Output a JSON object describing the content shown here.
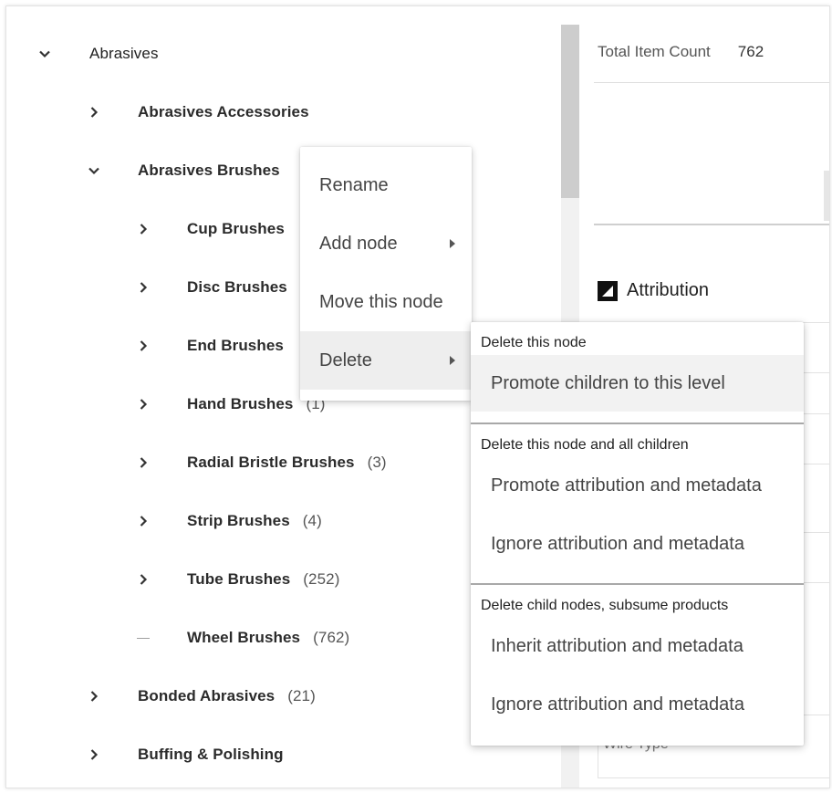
{
  "tree": {
    "root": {
      "label": "Abrasives",
      "expanded": true
    },
    "items": [
      {
        "label": "Abrasives Accessories",
        "count": "",
        "level": 1,
        "state": "collapsed"
      },
      {
        "label": "Abrasives Brushes",
        "count": "",
        "level": 1,
        "state": "expanded"
      },
      {
        "label": "Cup Brushes",
        "count": "",
        "level": 2,
        "state": "collapsed"
      },
      {
        "label": "Disc Brushes",
        "count": "",
        "level": 2,
        "state": "collapsed"
      },
      {
        "label": "End Brushes",
        "count": "",
        "level": 2,
        "state": "collapsed"
      },
      {
        "label": "Hand Brushes",
        "count": "(1)",
        "level": 2,
        "state": "collapsed"
      },
      {
        "label": "Radial Bristle Brushes",
        "count": "(3)",
        "level": 2,
        "state": "collapsed"
      },
      {
        "label": "Strip Brushes",
        "count": "(4)",
        "level": 2,
        "state": "collapsed"
      },
      {
        "label": "Tube Brushes",
        "count": "(252)",
        "level": 2,
        "state": "collapsed"
      },
      {
        "label": "Wheel Brushes",
        "count": "(762)",
        "level": 2,
        "state": "leaf"
      },
      {
        "label": "Bonded Abrasives",
        "count": "(21)",
        "level": 1,
        "state": "collapsed"
      },
      {
        "label": "Buffing & Polishing",
        "count": "",
        "level": 1,
        "state": "collapsed"
      }
    ]
  },
  "context_menu": {
    "items": [
      {
        "label": "Rename",
        "has_submenu": false
      },
      {
        "label": "Add node",
        "has_submenu": true
      },
      {
        "label": "Move this node",
        "has_submenu": false
      },
      {
        "label": "Delete",
        "has_submenu": true,
        "active": true
      }
    ]
  },
  "delete_submenu": {
    "groups": [
      {
        "heading": "Delete this node",
        "options": [
          "Promote children to this level"
        ]
      },
      {
        "heading": "Delete this node and all children",
        "options": [
          "Promote attribution and metadata",
          "Ignore attribution and metadata"
        ]
      },
      {
        "heading": "Delete child nodes, subsume products",
        "options": [
          "Inherit attribution and metadata",
          "Ignore attribution and metadata"
        ]
      }
    ]
  },
  "details": {
    "total_item_count_label": "Total Item Count",
    "total_item_count_value": "762",
    "attribution_title": "Attribution",
    "partial_field_label": "Wire Type"
  },
  "colors": {
    "text": "#2b2b2b",
    "menu_active_bg": "#eeeeee",
    "scroll_thumb": "#cdcdcd"
  },
  "icons": {
    "expand": "chevron-right-icon",
    "collapse": "chevron-down-icon",
    "submenu": "caret-right-icon",
    "attribution": "attribution-icon"
  }
}
